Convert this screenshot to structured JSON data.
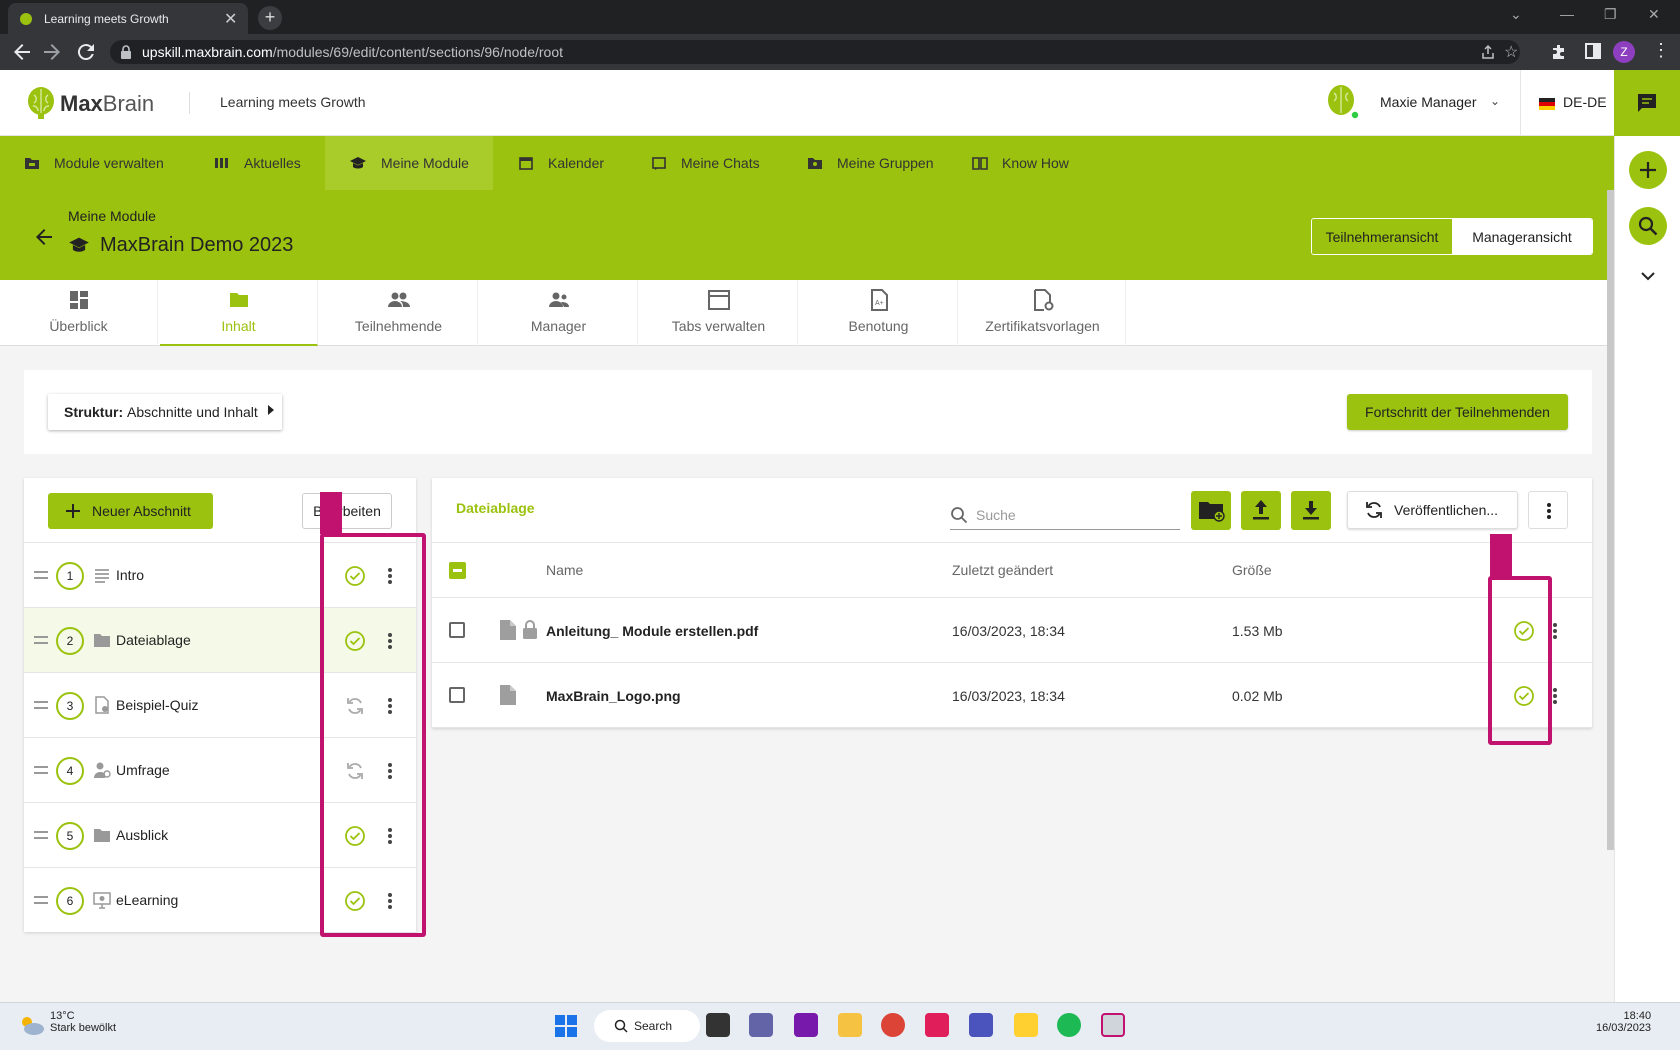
{
  "browser": {
    "tab_title": "Learning meets Growth",
    "url_host": "upskill.maxbrain.com",
    "url_path": "/modules/69/edit/content/sections/96/node/root",
    "profile_initial": "Z"
  },
  "app": {
    "logo_primary": "Max",
    "logo_secondary": "Brain",
    "tagline": "Learning meets Growth",
    "user_name": "Maxie Manager",
    "language": "DE-DE"
  },
  "nav": {
    "items": [
      {
        "label": "Module verwalten",
        "icon": "folder-manage-icon"
      },
      {
        "label": "Aktuelles",
        "icon": "news-icon"
      },
      {
        "label": "Meine Module",
        "icon": "graduation-cap-icon"
      },
      {
        "label": "Kalender",
        "icon": "calendar-icon"
      },
      {
        "label": "Meine Chats",
        "icon": "chat-icon"
      },
      {
        "label": "Meine Gruppen",
        "icon": "group-icon"
      },
      {
        "label": "Know How",
        "icon": "book-icon"
      }
    ],
    "active": "Meine Module"
  },
  "module": {
    "breadcrumb": "Meine Module",
    "title": "MaxBrain Demo 2023",
    "view_participant": "Teilnehmeransicht",
    "view_manager": "Manageransicht"
  },
  "subtabs": [
    {
      "label": "Überblick",
      "icon": "dashboard-icon"
    },
    {
      "label": "Inhalt",
      "icon": "folder-icon"
    },
    {
      "label": "Teilnehmende",
      "icon": "people-icon"
    },
    {
      "label": "Manager",
      "icon": "manager-icon"
    },
    {
      "label": "Tabs verwalten",
      "icon": "tabs-icon"
    },
    {
      "label": "Benotung",
      "icon": "grade-icon"
    },
    {
      "label": "Zertifikatsvorlagen",
      "icon": "certificate-icon"
    }
  ],
  "structure": {
    "label_bold": "Struktur:",
    "label_value": "Abschnitte und Inhalt",
    "progress_button": "Fortschritt der Teilnehmenden"
  },
  "sections": {
    "new_button": "Neuer Abschnitt",
    "edit_button": "Bearbeiten",
    "items": [
      {
        "num": "1",
        "label": "Intro",
        "type": "text",
        "status": "published"
      },
      {
        "num": "2",
        "label": "Dateiablage",
        "type": "folder",
        "status": "published"
      },
      {
        "num": "3",
        "label": "Beispiel-Quiz",
        "type": "quiz",
        "status": "sync"
      },
      {
        "num": "4",
        "label": "Umfrage",
        "type": "survey",
        "status": "sync"
      },
      {
        "num": "5",
        "label": "Ausblick",
        "type": "folder",
        "status": "published"
      },
      {
        "num": "6",
        "label": "eLearning",
        "type": "elearning",
        "status": "published"
      }
    ]
  },
  "files": {
    "title": "Dateiablage",
    "search_placeholder": "Suche",
    "publish_button": "Veröffentlichen...",
    "columns": {
      "name": "Name",
      "modified": "Zuletzt geändert",
      "size": "Größe"
    },
    "rows": [
      {
        "name": "Anleitung_ Module erstellen.pdf",
        "modified": "16/03/2023, 18:34",
        "size": "1.53 Mb",
        "locked": true
      },
      {
        "name": "MaxBrain_Logo.png",
        "modified": "16/03/2023, 18:34",
        "size": "0.02 Mb",
        "locked": false
      }
    ]
  },
  "taskbar": {
    "temperature": "13°C",
    "weather": "Stark bewölkt",
    "search": "Search",
    "time": "18:40",
    "date": "16/03/2023"
  },
  "colors": {
    "brand": "#9bc20e",
    "highlight": "#c0126e"
  }
}
